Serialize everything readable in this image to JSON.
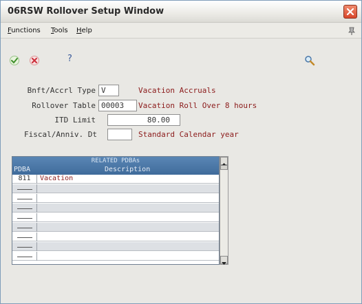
{
  "window": {
    "title": "06RSW   Rollover Setup Window"
  },
  "menu": [
    {
      "first": "F",
      "rest": "unctions"
    },
    {
      "first": "T",
      "rest": "ools"
    },
    {
      "first": "H",
      "rest": "elp"
    }
  ],
  "toolbar": {
    "help_label": "?"
  },
  "form": {
    "bnft_label": "Bnft/Accrl Type",
    "bnft_value": "V",
    "bnft_desc": "Vacation Accruals",
    "rollover_label": "Rollover Table",
    "rollover_value": "00003",
    "rollover_desc": "Vacation Roll Over 8 hours",
    "itd_label": "ITD Limit",
    "itd_value": "80.00",
    "fiscal_label": "Fiscal/Anniv. Dt",
    "fiscal_value": "",
    "fiscal_desc": "Standard Calendar year"
  },
  "grid": {
    "caption": "RELATED PDBAs",
    "columns": [
      "PDBA",
      "Description"
    ],
    "rows": [
      {
        "code": "811",
        "description": "Vacation"
      },
      {
        "code": "",
        "description": ""
      },
      {
        "code": "",
        "description": ""
      },
      {
        "code": "",
        "description": ""
      },
      {
        "code": "",
        "description": ""
      },
      {
        "code": "",
        "description": ""
      },
      {
        "code": "",
        "description": ""
      },
      {
        "code": "",
        "description": ""
      },
      {
        "code": "",
        "description": ""
      }
    ]
  }
}
